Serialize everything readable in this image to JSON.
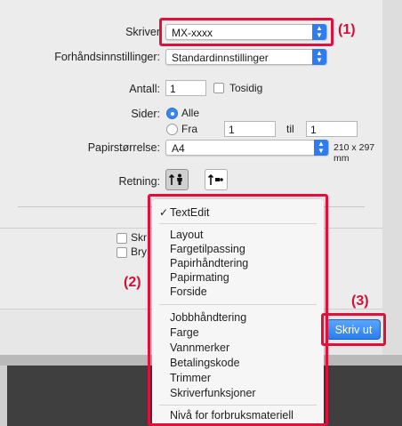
{
  "dialog": {
    "printer": {
      "label": "Skriver",
      "value": "MX-xxxx"
    },
    "presets": {
      "label": "Forhåndsinnstillinger:",
      "value": "Standardinnstillinger"
    },
    "copies": {
      "label": "Antall:",
      "value": "1",
      "two_sided_label": "Tosidig"
    },
    "pages": {
      "label": "Sider:",
      "all_label": "Alle",
      "from_label": "Fra",
      "from_value": "1",
      "to_label": "til",
      "to_value": "1"
    },
    "paper_size": {
      "label": "Papirstørrelse:",
      "value": "A4",
      "dimensions": "210 x 297 mm"
    },
    "orientation": {
      "label": "Retning:"
    },
    "hidden_checkboxes": [
      {
        "label": "Skr"
      },
      {
        "label": "Bry"
      }
    ],
    "print_button": "Skriv ut"
  },
  "popup_menu": {
    "checked_item": "TextEdit",
    "group1": [
      "Layout",
      "Fargetilpassing",
      "Papirhåndtering",
      "Papirmating",
      "Forside"
    ],
    "group2": [
      "Jobbhåndtering",
      "Farge",
      "Vannmerker",
      "Betalingskode",
      "Trimmer",
      "Skriverfunksjoner"
    ],
    "group3": [
      "Nivå for forbruksmateriell"
    ]
  },
  "callouts": {
    "c1": "(1)",
    "c2": "(2)",
    "c3": "(3)"
  },
  "colors": {
    "accent": "#2f7cf0",
    "callout_red": "#e0103d"
  },
  "icons": {
    "check": "checkmark-icon",
    "stepper": "updown-stepper-icon"
  }
}
